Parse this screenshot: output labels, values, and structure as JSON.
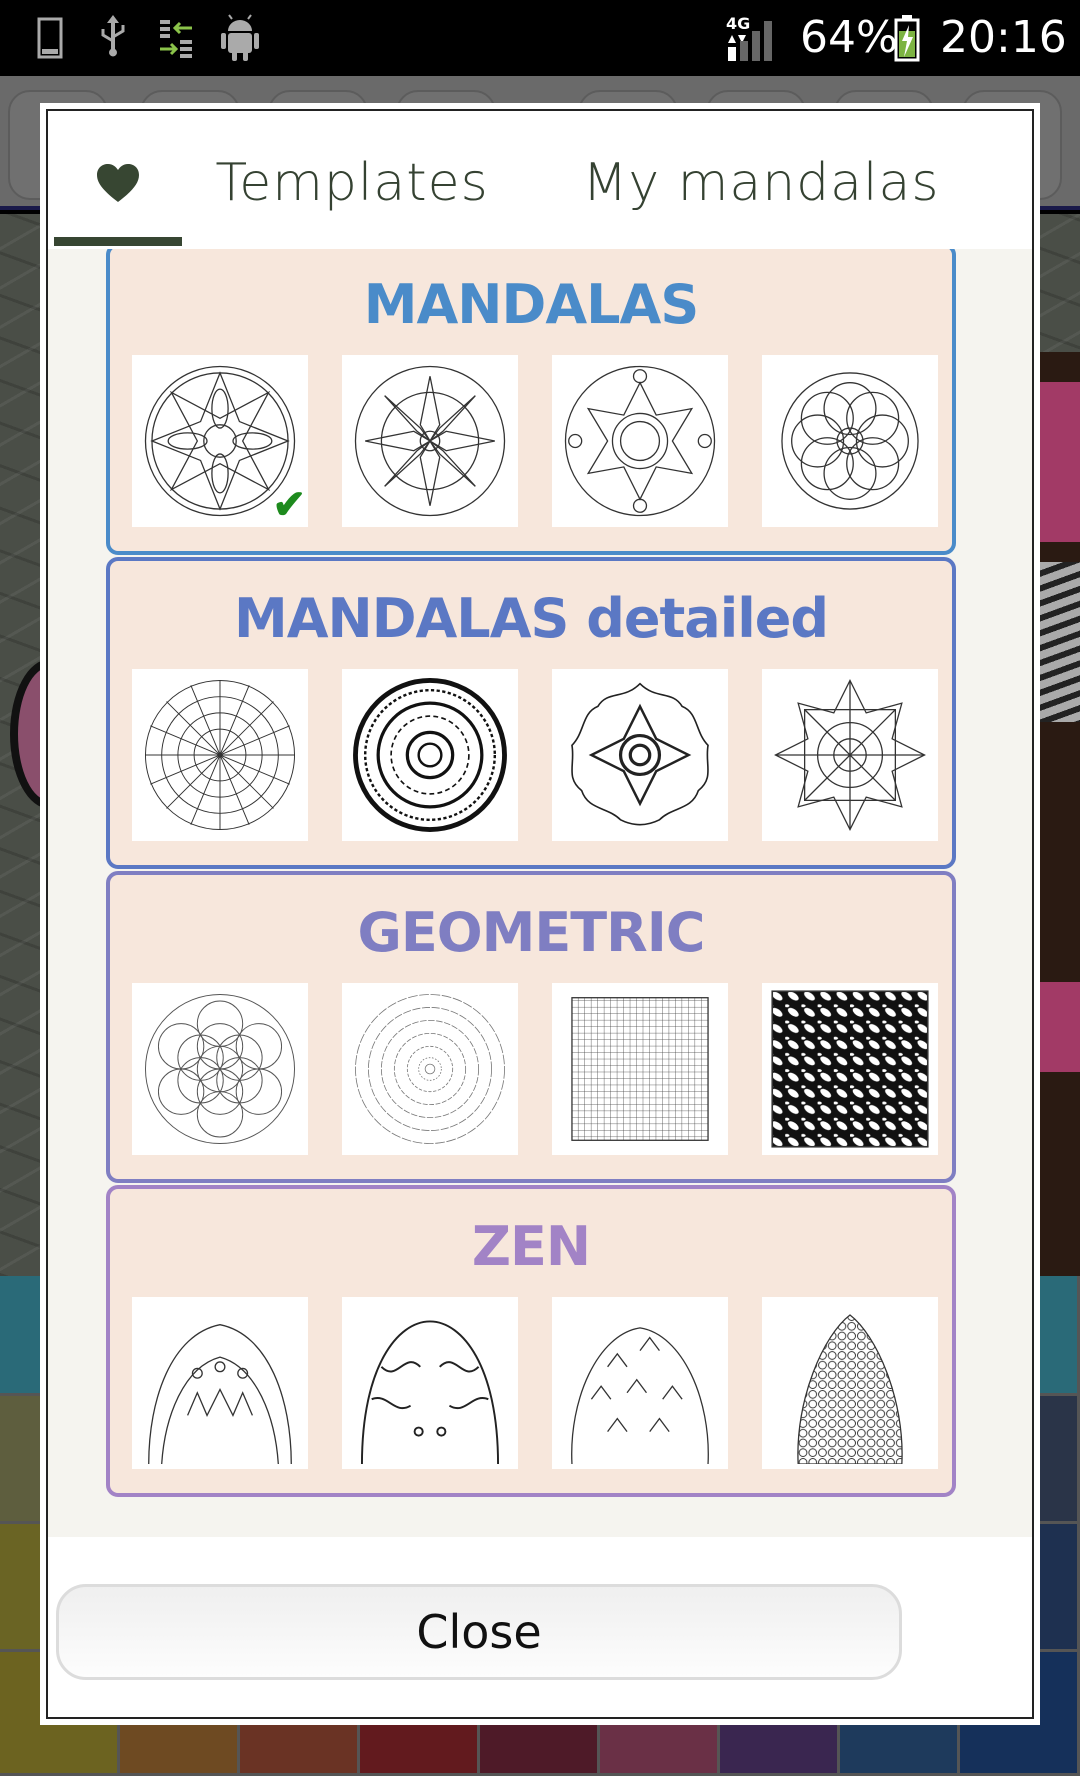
{
  "status_bar": {
    "left_icons": [
      "phone-outline-icon",
      "usb-icon",
      "sync-arrows-icon",
      "android-icon"
    ],
    "network_label": "4G",
    "battery_percent": "64%",
    "battery_icon": "battery-charging-icon",
    "time": "20:16"
  },
  "dialog": {
    "tabs": [
      {
        "id": "favorites",
        "icon": "heart-icon",
        "label": "",
        "selected": true
      },
      {
        "id": "templates",
        "label": "Templates",
        "selected": false
      },
      {
        "id": "my_mandalas",
        "label": "My mandalas",
        "selected": false
      }
    ],
    "categories": [
      {
        "title": "MANDALAS",
        "color": "#4a8bc9",
        "thumb_count": 4,
        "selected_thumb": 0
      },
      {
        "title": "MANDALAS detailed",
        "color": "#5b78c4",
        "thumb_count": 4
      },
      {
        "title": "GEOMETRIC",
        "color": "#7f7ec2",
        "thumb_count": 4
      },
      {
        "title": "ZEN",
        "color": "#a283c6",
        "thumb_count": 4
      }
    ],
    "selected_check": "✔",
    "close_label": "Close"
  },
  "colors": {
    "tab_text": "#354232",
    "tab_indicator": "#374632",
    "category_bg": "#f7e7dc",
    "selected_check": "#1d8a1d"
  }
}
